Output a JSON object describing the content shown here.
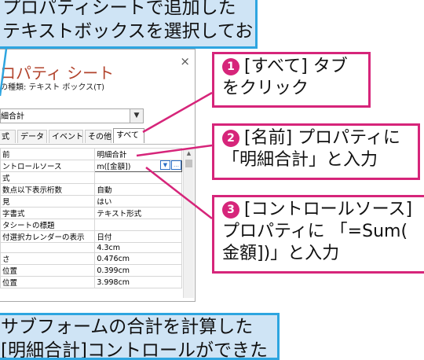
{
  "callouts": {
    "top_line1": "プロパティシートで追加した",
    "top_line2": "テキストボックスを選択しておく",
    "step1_num": "1",
    "step1_line1": "[すべて] タブ",
    "step1_line2": "をクリック",
    "step2_num": "2",
    "step2_line1": "[名前] プロパティに",
    "step2_line2": "「明細合計」と入力",
    "step3_num": "3",
    "step3_line1": "[コントロールソース]",
    "step3_line2": "プロパティに 「=Sum(",
    "step3_line3": "金額])」と入力",
    "bottom_line1": "サブフォームの合計を計算した",
    "bottom_line2": "[明細合計]コントロールができた"
  },
  "sheet": {
    "close": "×",
    "title": "ロパティ シート",
    "type_label": "の種類: テキスト ボックス(T)",
    "selected_object": "細合計",
    "tabs": [
      "式",
      "データ",
      "イベント",
      "その他",
      "すべて"
    ],
    "active_tab": "すべて",
    "rows": [
      {
        "label": "前",
        "value": "明細合計"
      },
      {
        "label": "ントロールソース",
        "value": "m([金額])"
      },
      {
        "label": "式",
        "value": ""
      },
      {
        "label": "数点以下表示桁数",
        "value": "自動"
      },
      {
        "label": "見",
        "value": "はい"
      },
      {
        "label": "字書式",
        "value": "テキスト形式"
      },
      {
        "label": "タシートの標題",
        "value": ""
      },
      {
        "label": "付選択カレンダーの表示",
        "value": "日付"
      },
      {
        "label": "",
        "value": "4.3cm"
      },
      {
        "label": "さ",
        "value": "0.476cm"
      },
      {
        "label": "位置",
        "value": "0.399cm"
      },
      {
        "label": "位置",
        "value": "3.998cm"
      }
    ]
  },
  "colors": {
    "blue_border": "#2ea5e0",
    "blue_fill": "#cfe4f5",
    "pink": "#d6257a",
    "title": "#b2442d"
  }
}
